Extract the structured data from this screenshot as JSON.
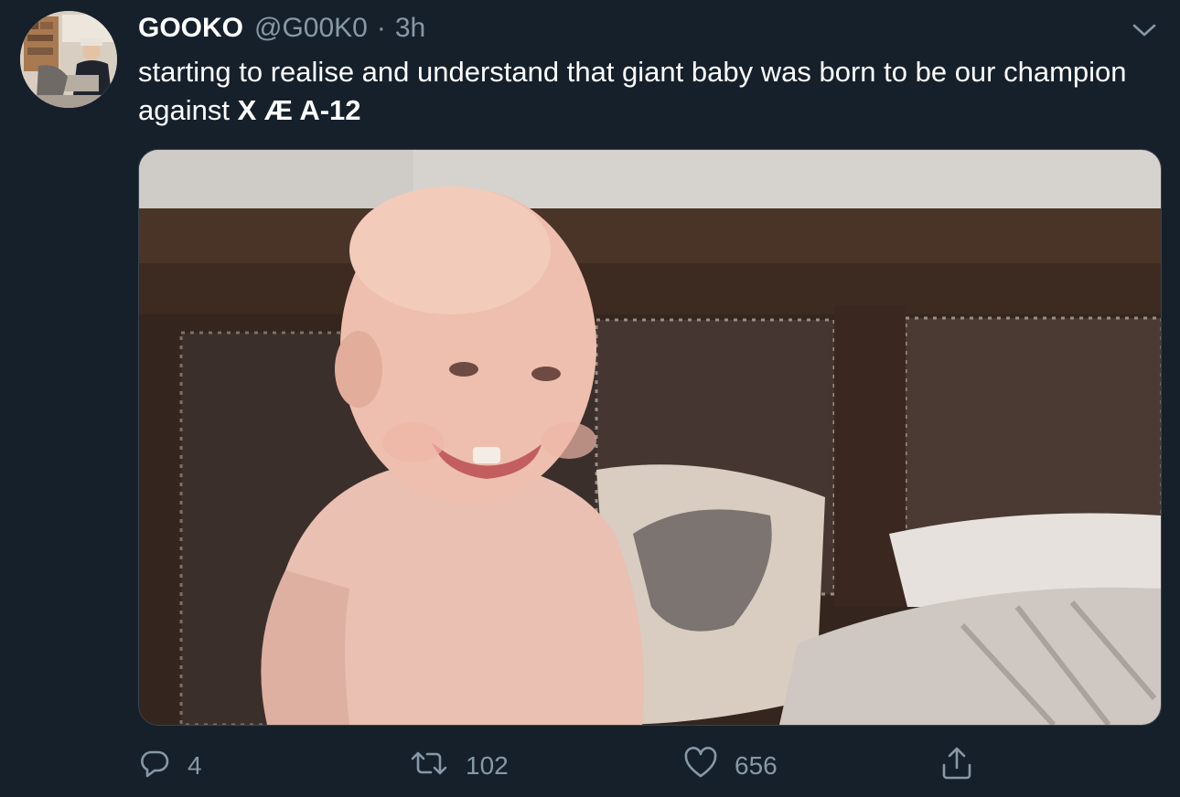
{
  "tweet": {
    "display_name": "GOOKO",
    "handle": "@G00K0",
    "separator": "·",
    "time": "3h",
    "text_plain": "starting to realise and understand that giant baby was born to be our champion against ",
    "text_bold": "X Æ A-12"
  },
  "media": {
    "kind": "gif",
    "subject": "baby"
  },
  "actions": {
    "reply_count": "4",
    "retweet_count": "102",
    "like_count": "656"
  },
  "icons": {
    "avatar": "avatar-photo",
    "caret": "chevron-down-icon",
    "reply": "reply-icon",
    "retweet": "retweet-icon",
    "like": "heart-icon",
    "share": "share-icon"
  },
  "colors": {
    "background": "#15202b",
    "text_primary": "#ffffff",
    "text_secondary": "#8899a6",
    "border": "#38444d"
  }
}
